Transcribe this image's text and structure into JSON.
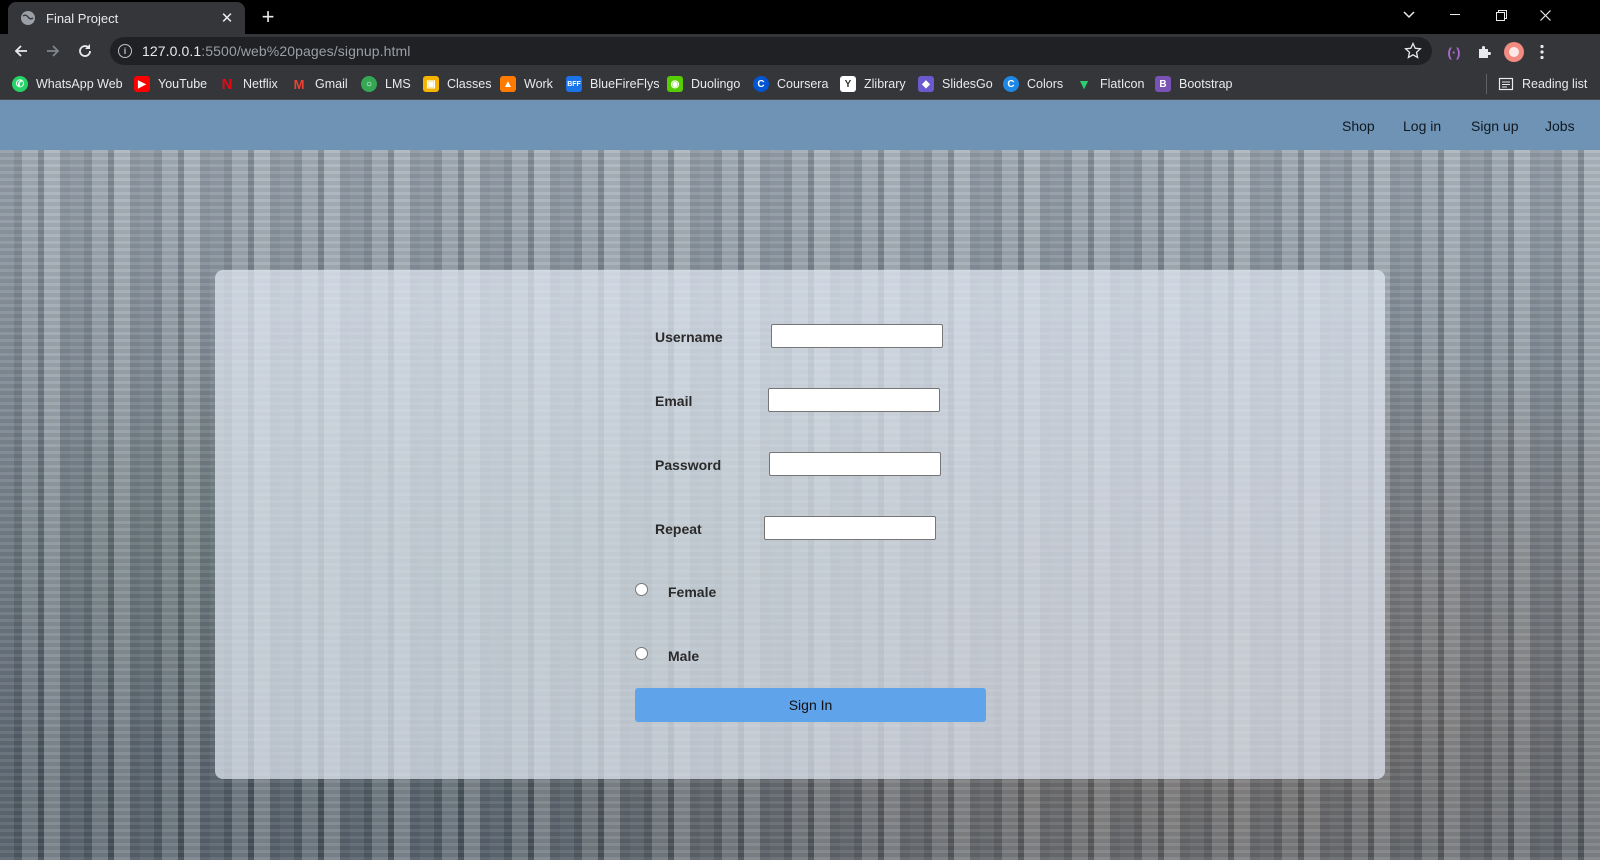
{
  "browser": {
    "tab_title": "Final Project",
    "url_host": "127.0.0.1",
    "url_rest": ":5500/web%20pages/signup.html",
    "reading_list": "Reading list"
  },
  "bookmarks": [
    {
      "label": "WhatsApp Web",
      "icon": "whatsapp-icon",
      "color": "#25d366"
    },
    {
      "label": "YouTube",
      "icon": "youtube-icon",
      "color": "#ff0000"
    },
    {
      "label": "Netflix",
      "icon": "netflix-icon",
      "color": "#e50914"
    },
    {
      "label": "Gmail",
      "icon": "gmail-icon",
      "color": "#ea4335"
    },
    {
      "label": "LMS",
      "icon": "lms-icon",
      "color": "#34a853"
    },
    {
      "label": "Classes",
      "icon": "classroom-icon",
      "color": "#f4b400"
    },
    {
      "label": "Work",
      "icon": "work-icon",
      "color": "#ff7a00"
    },
    {
      "label": "BlueFireFlys",
      "icon": "bluefireflys-icon",
      "color": "#1a73e8"
    },
    {
      "label": "Duolingo",
      "icon": "duolingo-icon",
      "color": "#58cc02"
    },
    {
      "label": "Coursera",
      "icon": "coursera-icon",
      "color": "#0056d2"
    },
    {
      "label": "Zlibrary",
      "icon": "zlibrary-icon",
      "color": "#ffffff"
    },
    {
      "label": "SlidesGo",
      "icon": "slidesgo-icon",
      "color": "#6a5acd"
    },
    {
      "label": "Colors",
      "icon": "colors-icon",
      "color": "#1e88e5"
    },
    {
      "label": "FlatIcon",
      "icon": "flaticon-icon",
      "color": "#2ecc71"
    },
    {
      "label": "Bootstrap",
      "icon": "bootstrap-icon",
      "color": "#7952b3"
    }
  ],
  "nav": {
    "shop": "Shop",
    "login": "Log in",
    "signup": "Sign up",
    "jobs": "Jobs"
  },
  "form": {
    "username_label": "Username",
    "email_label": "Email",
    "password_label": "Password",
    "repeat_label": "Repeat",
    "female_label": "Female",
    "male_label": "Male",
    "submit_label": "Sign In"
  },
  "colors": {
    "nav_bg": "#6e93b5",
    "button_bg": "#5fa3ea"
  }
}
